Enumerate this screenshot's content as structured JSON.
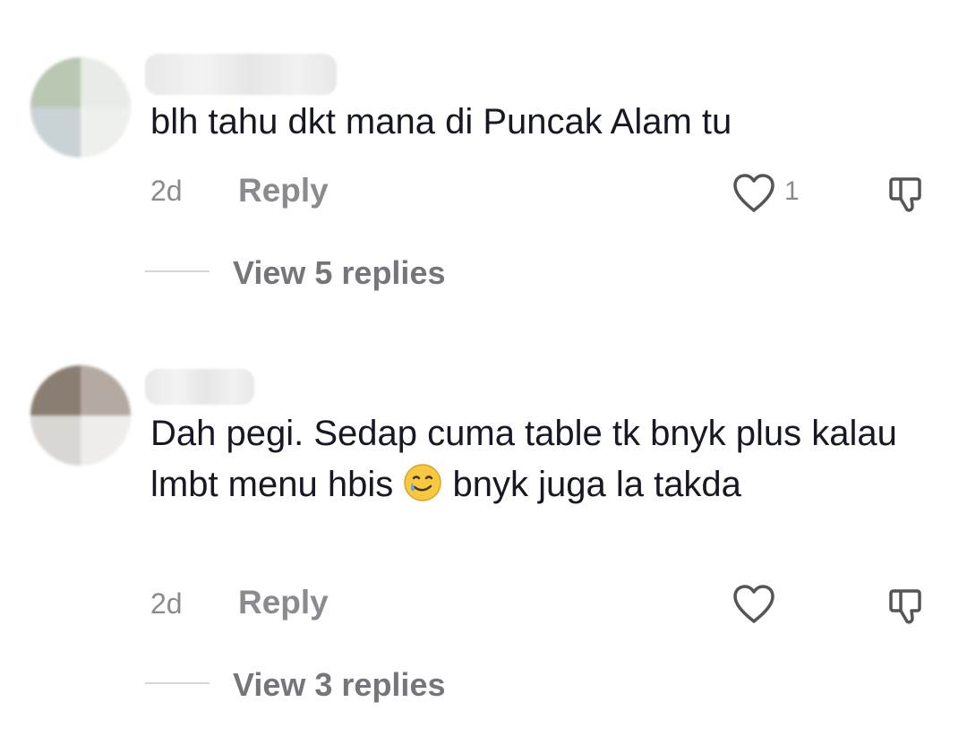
{
  "comments": [
    {
      "text": "blh tahu dkt mana di Puncak Alam tu",
      "time": "2d",
      "reply_label": "Reply",
      "like_count": "1",
      "view_replies": "View 5 replies"
    },
    {
      "text_part1": "Dah pegi. Sedap cuma table tk bnyk plus kalau lmbt menu hbis",
      "text_part2": " bnyk juga la takda",
      "emoji_icon": "smiling-face-with-tear-icon",
      "time": "2d",
      "reply_label": "Reply",
      "view_replies": "View 3 replies"
    }
  ],
  "colors": {
    "text": "#161823",
    "meta": "#8a8b91",
    "icon": "#555555"
  }
}
